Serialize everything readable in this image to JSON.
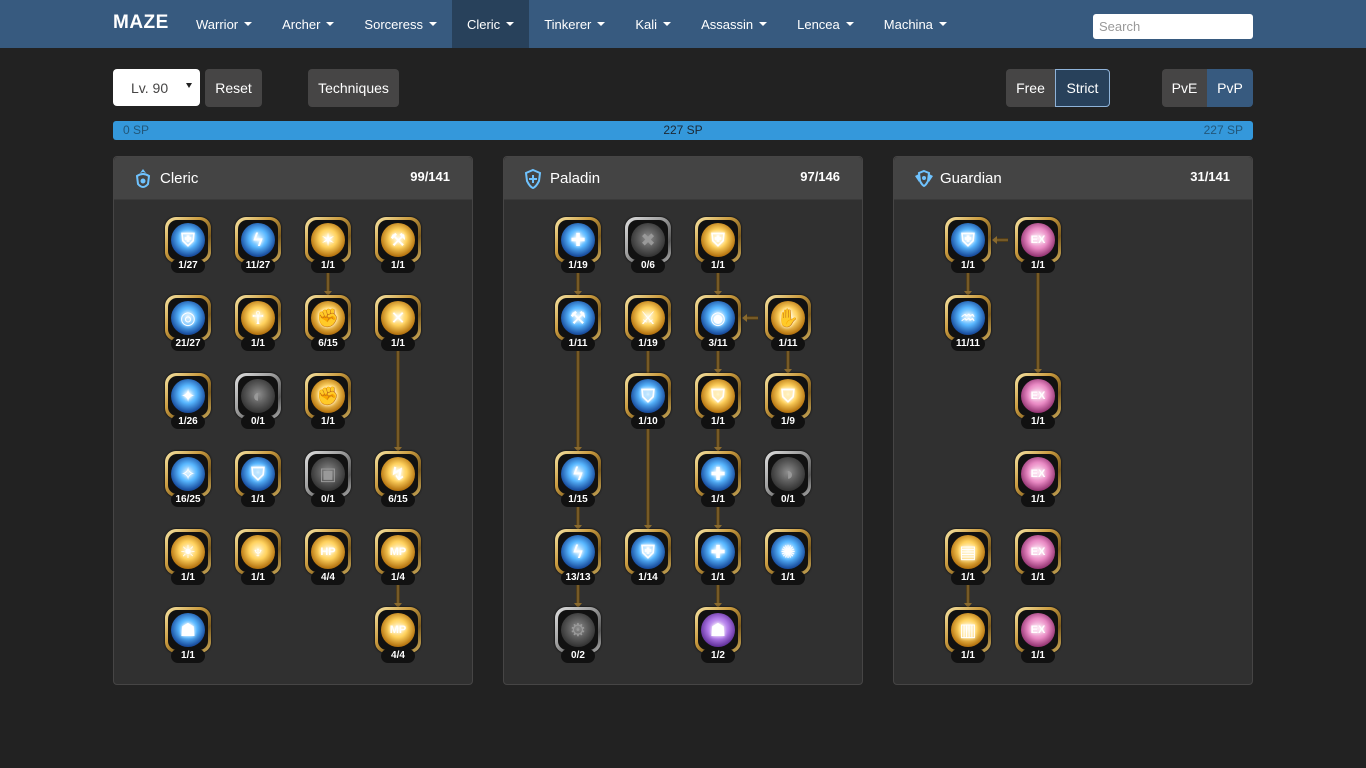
{
  "navbar": {
    "brand": "MAZE",
    "items": [
      {
        "label": "Warrior",
        "active": false
      },
      {
        "label": "Archer",
        "active": false
      },
      {
        "label": "Sorceress",
        "active": false
      },
      {
        "label": "Cleric",
        "active": true
      },
      {
        "label": "Tinkerer",
        "active": false
      },
      {
        "label": "Kali",
        "active": false
      },
      {
        "label": "Assassin",
        "active": false
      },
      {
        "label": "Lencea",
        "active": false
      },
      {
        "label": "Machina",
        "active": false
      }
    ],
    "search_placeholder": "Search"
  },
  "toolbar": {
    "level": "Lv. 90",
    "reset": "Reset",
    "techniques": "Techniques",
    "mode_free": "Free",
    "mode_strict": "Strict",
    "mode_selected": "Strict",
    "pve": "PvE",
    "pvp": "PvP",
    "game_mode_selected": "PvP"
  },
  "sp_bar": {
    "min": "0 SP",
    "current": "227 SP",
    "max": "227 SP",
    "fill_fraction": 1.0,
    "color": "#3498db"
  },
  "colors": {
    "navbar": "#375a7f",
    "background": "#222222",
    "active_nav": "#28415b"
  },
  "panels": [
    {
      "title": "Cleric",
      "count": "99/141",
      "icon": "cleric-emblem-icon",
      "skills": [
        {
          "col": 0,
          "row": 0,
          "level": "1/27",
          "tone": "blue",
          "glyph": "⛨",
          "icon": "shield-block-icon"
        },
        {
          "col": 1,
          "row": 0,
          "level": "11/27",
          "tone": "blue",
          "glyph": "ϟ",
          "icon": "lightning-icon"
        },
        {
          "col": 2,
          "row": 0,
          "level": "1/1",
          "tone": "gold",
          "glyph": "✶",
          "icon": "heal-burst-icon"
        },
        {
          "col": 3,
          "row": 0,
          "level": "1/1",
          "tone": "gold",
          "glyph": "⚒",
          "icon": "hammer-strike-icon"
        },
        {
          "col": 0,
          "row": 1,
          "level": "21/27",
          "tone": "blue",
          "glyph": "◎",
          "icon": "holy-orb-icon"
        },
        {
          "col": 1,
          "row": 1,
          "level": "1/1",
          "tone": "gold",
          "glyph": "☥",
          "icon": "blessing-icon"
        },
        {
          "col": 2,
          "row": 1,
          "level": "6/15",
          "tone": "gold",
          "glyph": "✊",
          "icon": "holy-fist-icon"
        },
        {
          "col": 3,
          "row": 1,
          "level": "1/1",
          "tone": "gold",
          "glyph": "✕",
          "icon": "cross-slash-icon"
        },
        {
          "col": 0,
          "row": 2,
          "level": "1/26",
          "tone": "blue",
          "glyph": "✦",
          "icon": "electric-spark-icon"
        },
        {
          "col": 1,
          "row": 2,
          "level": "0/1",
          "tone": "grey",
          "glyph": "◐",
          "icon": "locked-skill-icon"
        },
        {
          "col": 2,
          "row": 2,
          "level": "1/1",
          "tone": "gold",
          "glyph": "✊",
          "icon": "attack-up-icon"
        },
        {
          "col": 0,
          "row": 3,
          "level": "16/25",
          "tone": "blue",
          "glyph": "✧",
          "icon": "star-orb-icon"
        },
        {
          "col": 1,
          "row": 3,
          "level": "1/1",
          "tone": "blue",
          "glyph": "⛉",
          "icon": "shield-icon"
        },
        {
          "col": 2,
          "row": 3,
          "level": "0/1",
          "tone": "grey",
          "glyph": "▣",
          "icon": "locked-armor-icon"
        },
        {
          "col": 3,
          "row": 3,
          "level": "6/15",
          "tone": "gold",
          "glyph": "↯",
          "icon": "smite-icon"
        },
        {
          "col": 0,
          "row": 4,
          "level": "1/1",
          "tone": "gold",
          "glyph": "☀",
          "icon": "sun-burst-icon"
        },
        {
          "col": 1,
          "row": 4,
          "level": "1/1",
          "tone": "gold",
          "glyph": "♆",
          "icon": "divine-pose-icon"
        },
        {
          "col": 2,
          "row": 4,
          "level": "4/4",
          "tone": "gold",
          "glyph": "HP",
          "icon": "hp-up-icon"
        },
        {
          "col": 3,
          "row": 4,
          "level": "1/4",
          "tone": "gold",
          "glyph": "MP",
          "icon": "mp-up-icon"
        },
        {
          "col": 0,
          "row": 5,
          "level": "1/1",
          "tone": "blue",
          "glyph": "☗",
          "icon": "spirit-icon"
        },
        {
          "col": 3,
          "row": 5,
          "level": "4/4",
          "tone": "gold",
          "glyph": "MP",
          "icon": "mp-regen-icon"
        }
      ]
    },
    {
      "title": "Paladin",
      "count": "97/146",
      "icon": "paladin-shield-icon",
      "skills": [
        {
          "col": 0,
          "row": 0,
          "level": "1/19",
          "tone": "blue",
          "glyph": "✚",
          "icon": "holy-cross-icon"
        },
        {
          "col": 1,
          "row": 0,
          "level": "0/6",
          "tone": "grey",
          "glyph": "✖",
          "icon": "locked-cross-icon"
        },
        {
          "col": 2,
          "row": 0,
          "level": "1/1",
          "tone": "gold",
          "glyph": "⛨",
          "icon": "golden-shield-icon"
        },
        {
          "col": 0,
          "row": 1,
          "level": "1/11",
          "tone": "blue",
          "glyph": "⚒",
          "icon": "hammer-icon"
        },
        {
          "col": 1,
          "row": 1,
          "level": "1/19",
          "tone": "gold",
          "glyph": "⚔",
          "icon": "sword-strike-icon"
        },
        {
          "col": 2,
          "row": 1,
          "level": "3/11",
          "tone": "blue",
          "glyph": "◉",
          "icon": "vortex-icon"
        },
        {
          "col": 3,
          "row": 1,
          "level": "1/11",
          "tone": "gold",
          "glyph": "✋",
          "icon": "palm-icon"
        },
        {
          "col": 1,
          "row": 2,
          "level": "1/10",
          "tone": "blue",
          "glyph": "⛉",
          "icon": "broken-shield-icon"
        },
        {
          "col": 2,
          "row": 2,
          "level": "1/1",
          "tone": "gold",
          "glyph": "⛉",
          "icon": "gold-guard-icon"
        },
        {
          "col": 3,
          "row": 2,
          "level": "1/9",
          "tone": "gold",
          "glyph": "⛉",
          "icon": "gold-ward-icon"
        },
        {
          "col": 0,
          "row": 3,
          "level": "1/15",
          "tone": "blue",
          "glyph": "ϟ",
          "icon": "lightning-shield-icon"
        },
        {
          "col": 2,
          "row": 3,
          "level": "1/1",
          "tone": "blue",
          "glyph": "✚",
          "icon": "sacred-shield-icon"
        },
        {
          "col": 3,
          "row": 3,
          "level": "0/1",
          "tone": "grey",
          "glyph": "◑",
          "icon": "locked-swirl-icon"
        },
        {
          "col": 0,
          "row": 4,
          "level": "13/13",
          "tone": "blue",
          "glyph": "ϟ",
          "icon": "thunder-icon"
        },
        {
          "col": 1,
          "row": 4,
          "level": "1/14",
          "tone": "blue",
          "glyph": "⛨",
          "icon": "guard-icon"
        },
        {
          "col": 2,
          "row": 4,
          "level": "1/1",
          "tone": "blue",
          "glyph": "✚",
          "icon": "heal-aura-icon"
        },
        {
          "col": 3,
          "row": 4,
          "level": "1/1",
          "tone": "blue",
          "glyph": "✺",
          "icon": "starburst-icon"
        },
        {
          "col": 0,
          "row": 5,
          "level": "0/2",
          "tone": "grey",
          "glyph": "⚙",
          "icon": "locked-gear-icon"
        },
        {
          "col": 2,
          "row": 5,
          "level": "1/2",
          "tone": "purple",
          "glyph": "☗",
          "icon": "ultimate-icon"
        }
      ]
    },
    {
      "title": "Guardian",
      "count": "31/141",
      "icon": "guardian-crest-icon",
      "skills": [
        {
          "col": 0,
          "row": 0,
          "level": "1/1",
          "tone": "blue",
          "glyph": "⛨",
          "icon": "crest-shield-icon"
        },
        {
          "col": 1,
          "row": 0,
          "level": "1/1",
          "tone": "pink",
          "glyph": "EX",
          "icon": "ex-skill-icon"
        },
        {
          "col": 0,
          "row": 1,
          "level": "11/11",
          "tone": "blue",
          "glyph": "♒",
          "icon": "whirlwind-icon"
        },
        {
          "col": 1,
          "row": 2,
          "level": "1/1",
          "tone": "pink",
          "glyph": "EX",
          "icon": "ex-skill-icon"
        },
        {
          "col": 1,
          "row": 3,
          "level": "1/1",
          "tone": "pink",
          "glyph": "EX",
          "icon": "ex-skill-icon"
        },
        {
          "col": 0,
          "row": 4,
          "level": "1/1",
          "tone": "gold",
          "glyph": "▤",
          "icon": "scroll-icon"
        },
        {
          "col": 1,
          "row": 4,
          "level": "1/1",
          "tone": "pink",
          "glyph": "EX",
          "icon": "ex-skill-icon"
        },
        {
          "col": 0,
          "row": 5,
          "level": "1/1",
          "tone": "gold",
          "glyph": "▥",
          "icon": "tome-icon"
        },
        {
          "col": 1,
          "row": 5,
          "level": "1/1",
          "tone": "pink",
          "glyph": "EX",
          "icon": "ex-skill-icon"
        }
      ]
    }
  ]
}
